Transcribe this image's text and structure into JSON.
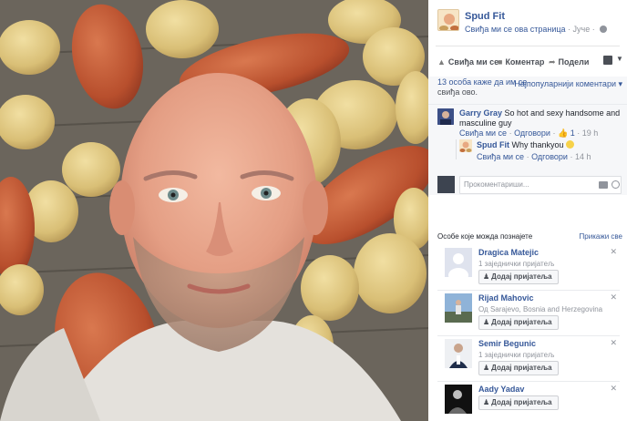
{
  "post": {
    "page_name": "Spud Fit",
    "liked_label": "Свиђа ми се ова страница",
    "time": "Јуче",
    "privacy_icon": "globe-icon"
  },
  "actions": {
    "like": "Свиђа ми се",
    "comment": "Коментар",
    "share": "Подели"
  },
  "reactions": {
    "likes_line1": "13 особа каже да им се",
    "likes_line2": "свиђа ово.",
    "sort_label": "Најпопуларнији коментари ▾"
  },
  "comments": [
    {
      "author": "Garry Gray",
      "text": "So hot and sexy handsome and masculine guy",
      "like": "Свиђа ми се",
      "reply": "Одговори",
      "like_count": "1",
      "time": "19 h"
    },
    {
      "author": "Spud Fit",
      "text": "Why thankyou",
      "like": "Свиђа ми се",
      "reply": "Одговори",
      "time": "14 h"
    }
  ],
  "composer": {
    "placeholder": "Прокоментариши..."
  },
  "pymk": {
    "title": "Особе које можда познајете",
    "see_all": "Прикажи све",
    "add_label": "Додај пријатеља",
    "people": [
      {
        "name": "Dragica Matejic",
        "sub": "1 заједнички пријатељ"
      },
      {
        "name": "Rijad Mahovic",
        "sub": "Од Sarajevo, Bosnia and Herzegovina"
      },
      {
        "name": "Semir Begunic",
        "sub": "1 заједнички пријатељ"
      },
      {
        "name": "Aady Yadav",
        "sub": ""
      }
    ]
  },
  "colors": {
    "link": "#365899",
    "muted": "#90949c",
    "panel_bg": "#f6f7f9"
  }
}
